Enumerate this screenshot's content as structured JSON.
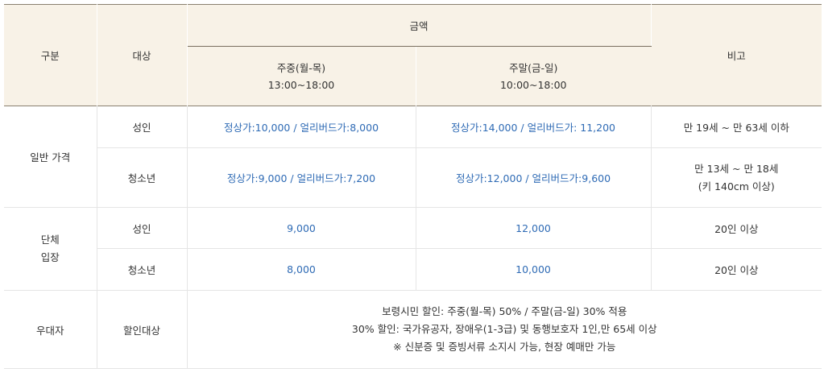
{
  "header": {
    "col_category": "구분",
    "col_target": "대상",
    "col_amount": "금액",
    "col_weekday": "주중(월-목)",
    "col_weekday_time": "13:00~18:00",
    "col_weekend": "주말(금-일)",
    "col_weekend_time": "10:00~18:00",
    "col_remark": "비고"
  },
  "general": {
    "label": "일반 가격",
    "adult": {
      "target": "성인",
      "weekday": "정상가:10,000 / 얼리버드가:8,000",
      "weekend": "정상가:14,000 / 얼리버드가: 11,200",
      "remark": "만 19세 ~ 만 63세 이하"
    },
    "youth": {
      "target": "청소년",
      "weekday": "정상가:9,000 / 얼리버드가:7,200",
      "weekend": "정상가:12,000 / 얼리버드가:9,600",
      "remark_line1": "만 13세 ~ 만 18세",
      "remark_line2": "(키 140cm 이상)"
    }
  },
  "group": {
    "label_line1": "단체",
    "label_line2": "입장",
    "adult": {
      "target": "성인",
      "weekday": "9,000",
      "weekend": "12,000",
      "remark": "20인 이상"
    },
    "youth": {
      "target": "청소년",
      "weekday": "8,000",
      "weekend": "10,000",
      "remark": "20인 이상"
    }
  },
  "preferential": {
    "label": "우대자",
    "target": "할인대상",
    "line1": "보령시민 할인: 주중(월-목) 50% / 주말(금-일) 30% 적용",
    "line2": "30% 할인: 국가유공자, 장애우(1-3급) 및 동행보호자 1인,만 65세 이상",
    "line3": "※ 신분증 및 증빙서류 소지시 가능, 현장 예매만 가능"
  },
  "colors": {
    "header_bg": "#f8f2e7",
    "price_text": "#2f6bb5",
    "border": "#e5e5e5",
    "header_border": "#8a8070"
  }
}
